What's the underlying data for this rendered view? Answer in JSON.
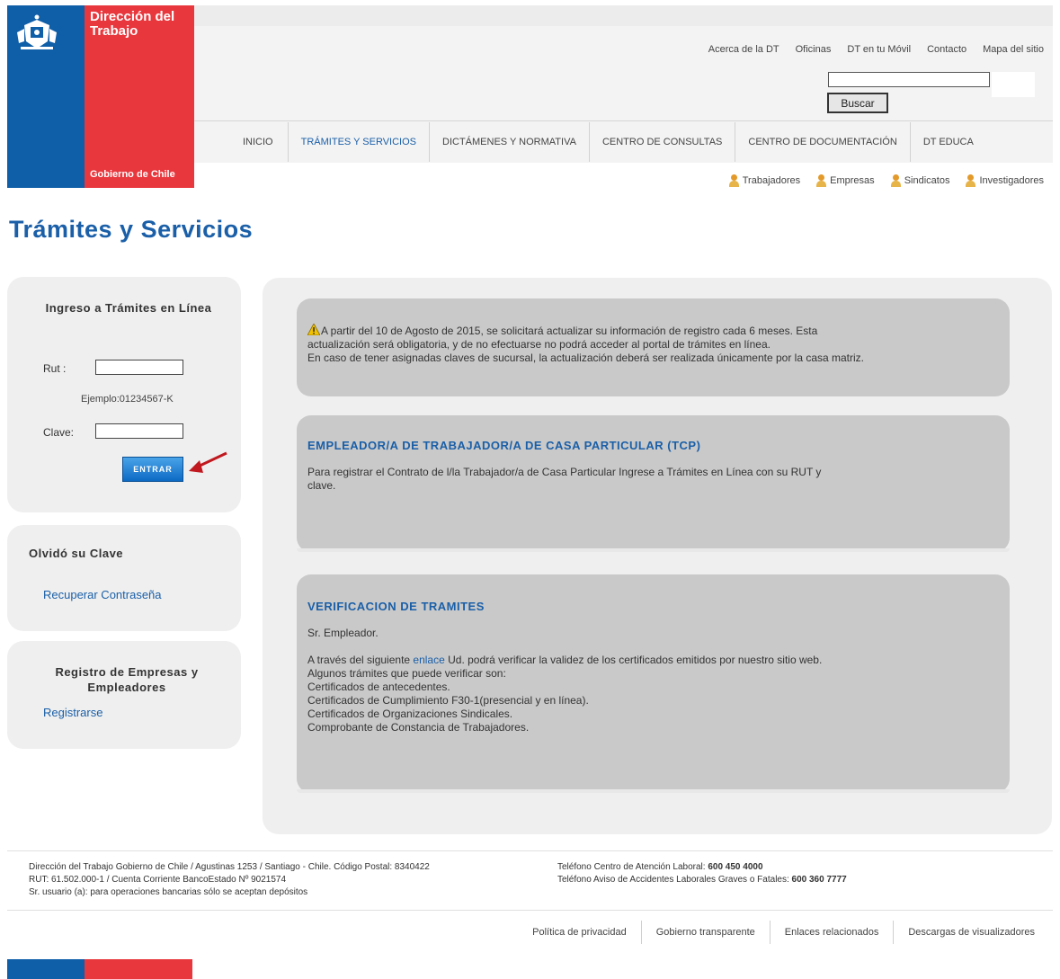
{
  "logo": {
    "title_line1": "Dirección del",
    "title_line2": "Trabajo",
    "government": "Gobierno de Chile"
  },
  "top_links": [
    "Acerca de la DT",
    "Oficinas",
    "DT en tu Móvil",
    "Contacto",
    "Mapa del sitio"
  ],
  "search": {
    "value": "",
    "button_label": "Buscar"
  },
  "nav": [
    "INICIO",
    "TRÁMITES Y SERVICIOS",
    "DICTÁMENES Y NORMATIVA",
    "CENTRO DE CONSULTAS",
    "CENTRO DE DOCUMENTACIÓN",
    "DT EDUCA"
  ],
  "nav_active_index": 1,
  "audience": [
    "Trabajadores",
    "Empresas",
    "Sindicatos",
    "Investigadores"
  ],
  "page_title": "Trámites y Servicios",
  "login": {
    "title": "Ingreso a Trámites en Línea",
    "rut_label": "Rut :",
    "rut_value": "",
    "example": "Ejemplo:01234567-K",
    "clave_label": "Clave:",
    "clave_value": "",
    "enter_label": "ENTRAR"
  },
  "forgot": {
    "title": "Olvidó su Clave",
    "link": "Recuperar Contraseña"
  },
  "register": {
    "title": "Registro de Empresas y Empleadores",
    "link": "Registrarse"
  },
  "notice": {
    "line1": "A partir del 10 de Agosto de 2015, se solicitará actualizar su información de registro cada 6 meses. Esta",
    "line2": "actualización será obligatoria, y de no efectuarse no podrá acceder al portal de trámites en línea.",
    "line3": "En caso de tener asignadas claves de sucursal, la actualización deberá ser realizada únicamente por la casa matriz."
  },
  "tcp": {
    "title": "EMPLEADOR/A DE TRABAJADOR/A DE CASA PARTICULAR (TCP)",
    "line1": "Para registrar el Contrato de l/la Trabajador/a de Casa Particular Ingrese a Trámites en Línea con su RUT y",
    "line2": "clave."
  },
  "verificacion": {
    "title": "VERIFICACION DE TRAMITES",
    "salutation": "Sr. Empleador.",
    "text_before_link": "A través del siguiente ",
    "link": "enlace",
    "text_after_link": " Ud. podrá verificar la validez de los certificados emitidos por nuestro sitio web.",
    "list_intro": "Algunos trámites que puede verificar son:",
    "items": [
      "Certificados de antecedentes.",
      "Certificados de Cumplimiento F30-1(presencial y en línea).",
      "Certificados de Organizaciones Sindicales.",
      "Comprobante de Constancia de Trabajadores."
    ]
  },
  "footer": {
    "left_line1": "Dirección del Trabajo Gobierno de Chile / Agustinas 1253 / Santiago - Chile. Código Postal: 8340422",
    "left_line2": "RUT: 61.502.000-1 / Cuenta Corriente BancoEstado Nº 9021574",
    "left_line3": "Sr. usuario (a): para operaciones bancarias sólo se aceptan depósitos",
    "right_line1_label": "Teléfono Centro de Atención Laboral: ",
    "right_line1_value": "600 450 4000",
    "right_line2_label": "Teléfono Aviso de Accidentes Laborales Graves o Fatales: ",
    "right_line2_value": "600 360 7777",
    "links": [
      "Política de privacidad",
      "Gobierno transparente",
      "Enlaces relacionados",
      "Descargas de visualizadores"
    ]
  },
  "colors": {
    "brand_blue": "#0f5ea8",
    "brand_red": "#e8373d",
    "link_blue": "#1a5fa8"
  }
}
